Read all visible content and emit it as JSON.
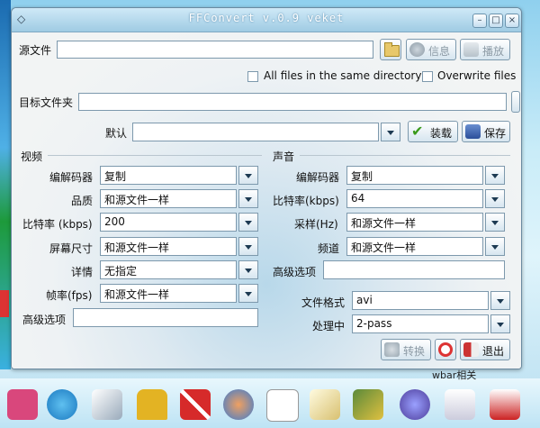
{
  "window": {
    "title": "FFConvert v.0.9  veket"
  },
  "source": {
    "label": "源文件",
    "value": "",
    "info_label": "信息",
    "play_label": "播放"
  },
  "options": {
    "same_dir_label": "All files in the same directory",
    "overwrite_label": "Overwrite files"
  },
  "target": {
    "label": "目标文件夹",
    "value": ""
  },
  "preset": {
    "label": "默认",
    "value": "",
    "load_label": "装载",
    "save_label": "保存"
  },
  "video": {
    "title": "视频",
    "codec_label": "编解码器",
    "codec_value": "复制",
    "quality_label": "品质",
    "quality_value": "和源文件一样",
    "bitrate_label": "比特率 (kbps)",
    "bitrate_value": "200",
    "screen_label": "屏幕尺寸",
    "screen_value": "和源文件一样",
    "detail_label": "详情",
    "detail_value": "无指定",
    "fps_label": "帧率(fps)",
    "fps_value": "和源文件一样",
    "advanced_label": "高级选项",
    "advanced_value": ""
  },
  "audio": {
    "title": "声音",
    "codec_label": "编解码器",
    "codec_value": "复制",
    "bitrate_label": "比特率(kbps)",
    "bitrate_value": "64",
    "sample_label": "采样(Hz)",
    "sample_value": "和源文件一样",
    "channel_label": "频道",
    "channel_value": "和源文件一样",
    "advanced_label": "高级选项",
    "advanced_value": ""
  },
  "output": {
    "format_label": "文件格式",
    "format_value": "avi",
    "process_label": "处理中",
    "process_value": "2-pass"
  },
  "actions": {
    "convert_label": "转换",
    "quit_label": "退出"
  },
  "desktop": {
    "label": "wbar相关"
  },
  "colors": {
    "accent": "#9fcbe3",
    "window_bg": "#f2f4f4",
    "border": "#7d99ad"
  }
}
